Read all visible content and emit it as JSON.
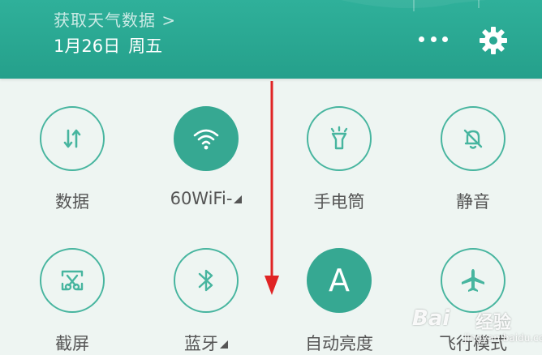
{
  "header": {
    "weather_link": "获取天气数据 >",
    "date": "1月26日",
    "weekday": "周五",
    "more_icon": "more-horizontal-icon",
    "settings_icon": "gear-icon",
    "accent_color": "#2aa893"
  },
  "tiles": [
    {
      "label": "数据",
      "icon": "data-transfer-icon",
      "active": false
    },
    {
      "label": "60WiFi-",
      "icon": "wifi-icon",
      "active": true,
      "has_indicator": true
    },
    {
      "label": "手电筒",
      "icon": "flashlight-icon",
      "active": false
    },
    {
      "label": "静音",
      "icon": "bell-off-icon",
      "active": false
    },
    {
      "label": "截屏",
      "icon": "screenshot-icon",
      "active": false
    },
    {
      "label": "蓝牙",
      "icon": "bluetooth-icon",
      "active": false,
      "has_indicator": true
    },
    {
      "label": "自动亮度",
      "icon": "auto-brightness-icon",
      "active": true,
      "glyph": "A"
    },
    {
      "label": "飞行模式",
      "icon": "airplane-icon",
      "active": false
    }
  ],
  "annotation": {
    "color": "#e02424"
  },
  "watermark": {
    "brand": "Bai",
    "cn": "经验",
    "url": "jingyan.baidu.com"
  }
}
